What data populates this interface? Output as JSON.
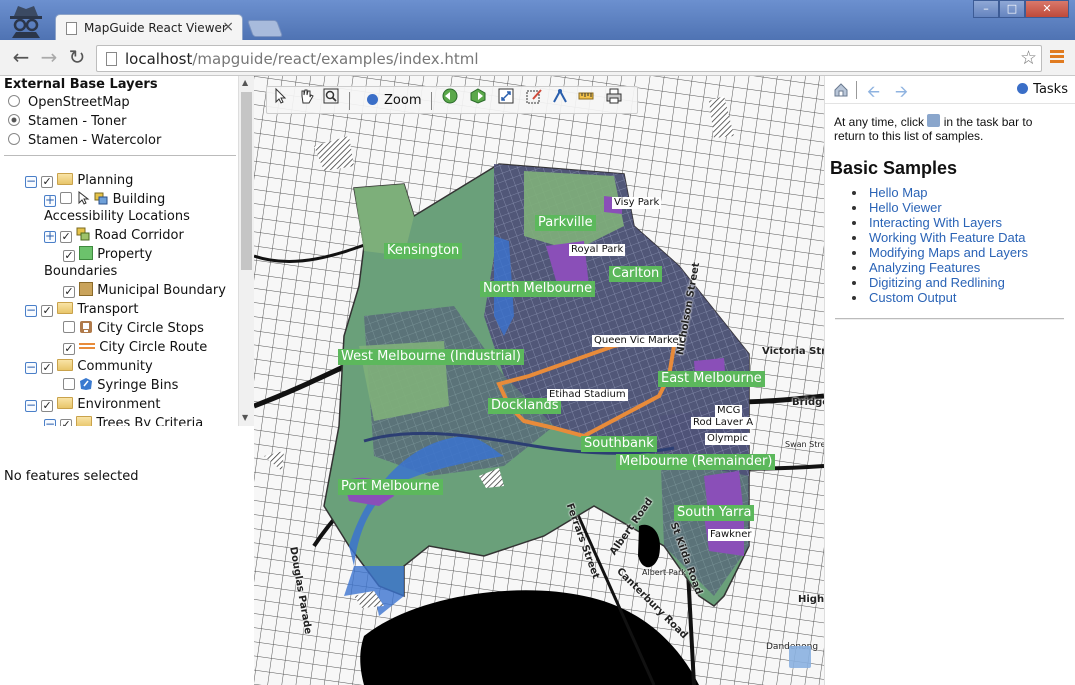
{
  "browser": {
    "tab_title": "MapGuide React Viewer",
    "tab_close": "×",
    "url_host": "localhost",
    "url_path": "/mapguide/react/examples/index.html",
    "win_min": "–",
    "win_max": "□",
    "win_close": "✕"
  },
  "left_panel": {
    "base_layers_title": "External Base Layers",
    "base_layers": [
      {
        "label": "OpenStreetMap",
        "selected": false
      },
      {
        "label": "Stamen - Toner",
        "selected": true
      },
      {
        "label": "Stamen - Watercolor",
        "selected": false
      }
    ],
    "tree": {
      "planning": "Planning",
      "building_1": "Building",
      "building_2": "Accessibility Locations",
      "road_corridor": "Road Corridor",
      "property_1": "Property",
      "property_2": "Boundaries",
      "municipal_boundary": "Municipal Boundary",
      "transport": "Transport",
      "city_circle_stops": "City Circle Stops",
      "city_circle_route": "City Circle Route",
      "community": "Community",
      "syringe_bins": "Syringe Bins",
      "environment": "Environment",
      "trees_by_criteria": "Trees By Criteria"
    },
    "selection_status": "No features selected"
  },
  "map": {
    "zoom_label": "Zoom",
    "suburbs": [
      "Kensington",
      "Parkville",
      "North Melbourne",
      "Carlton",
      "West Melbourne (Industrial)",
      "East Melbourne",
      "Docklands",
      "Southbank",
      "Melbourne (Remainder)",
      "Port Melbourne",
      "South Yarra"
    ],
    "poi": [
      "Visy Park",
      "Royal Park",
      "Queen Vic Market",
      "Etihad Stadium",
      "MCG",
      "Rod Laver A",
      "Olympic",
      "Fawkner"
    ],
    "streets": [
      "Nicholson Street",
      "Victoria Street",
      "Bridge",
      "Swan Street",
      "Ferrars Street",
      "Albert Road",
      "St Kilda Road",
      "Canterbury Road",
      "Douglas Parade",
      "Albert Park",
      "High S",
      "Dandenong"
    ]
  },
  "tasks": {
    "tasks_label": "Tasks",
    "intro_pre": "At any time, click",
    "intro_post": "in the task bar to return to this list of samples.",
    "heading": "Basic Samples",
    "samples": [
      "Hello Map",
      "Hello Viewer",
      "Interacting With Layers",
      "Working With Feature Data",
      "Modifying Maps and Layers",
      "Analyzing Features",
      "Digitizing and Redlining",
      "Custom Output"
    ]
  },
  "colors": {
    "suburb_label_bg": "#5cb85c",
    "link": "#2a63b6",
    "chrome_blue": "#5b7fbf"
  }
}
